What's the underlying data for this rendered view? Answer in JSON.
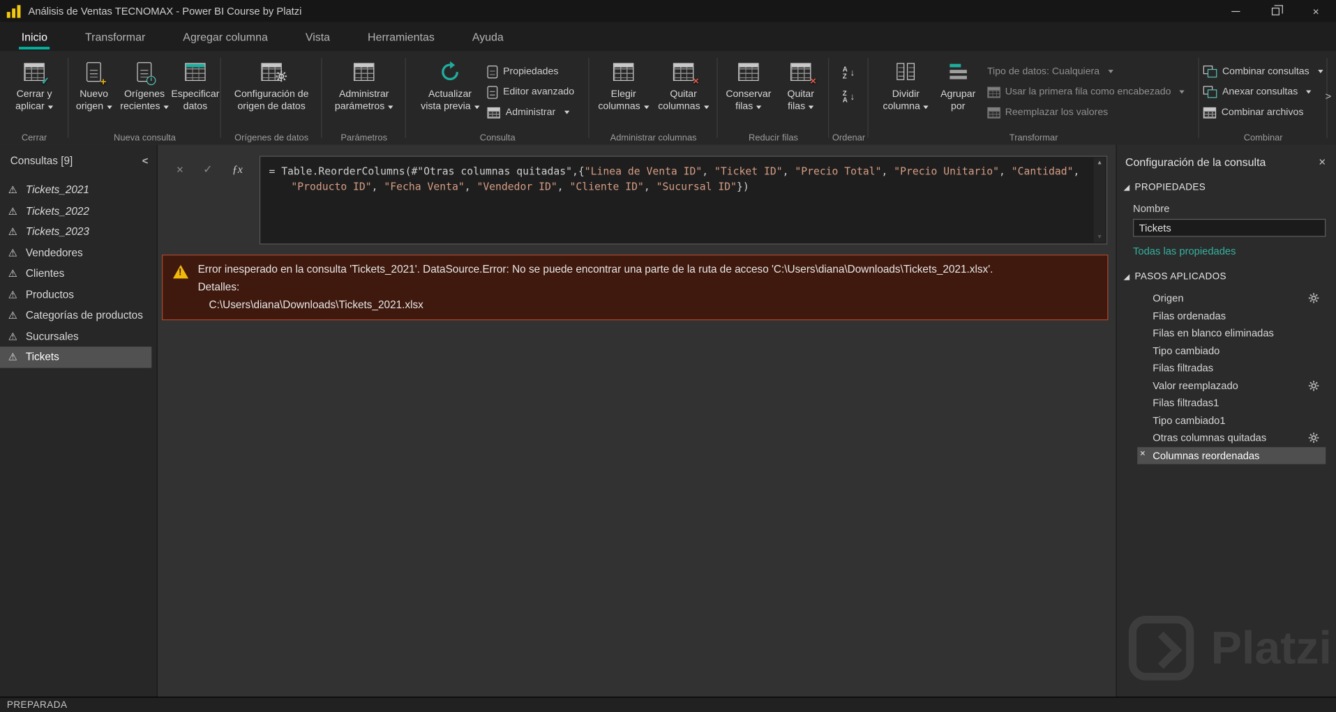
{
  "icons": {
    "close": "×",
    "check": "✓",
    "fx": "ƒx",
    "warning": "⚠",
    "scroll_up": "▲",
    "scroll_down": "▼",
    "collapse_left": "<",
    "overflow_right": ">",
    "plus": "+",
    "sort_a": "A",
    "sort_z": "Z",
    "arrow_down": "↓",
    "delete_x": "×"
  },
  "window": {
    "title": "Análisis de Ventas TECNOMAX - Power BI Course by Platzi"
  },
  "tabs": [
    "Inicio",
    "Transformar",
    "Agregar columna",
    "Vista",
    "Herramientas",
    "Ayuda"
  ],
  "ribbon": {
    "cerrar": {
      "label": "Cerrar",
      "close_apply": "Cerrar y aplicar"
    },
    "nueva": {
      "label": "Nueva consulta",
      "nuevo_origen": "Nuevo origen",
      "origenes_recientes": "Orígenes recientes",
      "especificar_datos": "Especificar datos"
    },
    "origenes": {
      "label": "Orígenes de datos",
      "configuracion": "Configuración de origen de datos"
    },
    "parametros": {
      "label": "Parámetros",
      "administrar": "Administrar parámetros"
    },
    "consulta": {
      "label": "Consulta",
      "actualizar": "Actualizar vista previa",
      "propiedades": "Propiedades",
      "editor_avanzado": "Editor avanzado",
      "administrar": "Administrar"
    },
    "columnas": {
      "label": "Administrar columnas",
      "elegir": "Elegir columnas",
      "quitar": "Quitar columnas"
    },
    "filas": {
      "label": "Reducir filas",
      "conservar": "Conservar filas",
      "quitar": "Quitar filas"
    },
    "ordenar": {
      "label": "Ordenar"
    },
    "transformar": {
      "label": "Transformar",
      "dividir": "Dividir columna",
      "agrupar": "Agrupar por",
      "tipo_datos": "Tipo de datos: Cualquiera",
      "primera_fila": "Usar la primera fila como encabezado",
      "reemplazar": "Reemplazar los valores"
    },
    "combinar": {
      "label": "Combinar",
      "combinar_consultas": "Combinar consultas",
      "anexar_consultas": "Anexar consultas",
      "combinar_archivos": "Combinar archivos"
    }
  },
  "sidebar": {
    "header": "Consultas [9]",
    "items": [
      "Tickets_2021",
      "Tickets_2022",
      "Tickets_2023",
      "Vendedores",
      "Clientes",
      "Productos",
      "Categorías de productos",
      "Sucursales",
      "Tickets"
    ]
  },
  "formula": {
    "p1": "= Table.ReorderColumns(",
    "identifier": "#\"Otras columnas quitadas\"",
    "p2": ",{",
    "sep": ", ",
    "trail": ",",
    "close": "})",
    "cols": [
      "\"Linea de Venta ID\"",
      "\"Ticket ID\"",
      "\"Precio Total\"",
      "\"Precio Unitario\"",
      "\"Cantidad\"",
      "\"Producto ID\"",
      "\"Fecha Venta\"",
      "\"Vendedor ID\"",
      "\"Cliente ID\"",
      "\"Sucursal ID\""
    ]
  },
  "error": {
    "message": "Error inesperado en la consulta 'Tickets_2021'. DataSource.Error: No se puede encontrar una parte de la ruta de acceso 'C:\\Users\\diana\\Downloads\\Tickets_2021.xlsx'.",
    "details_label": "Detalles:",
    "details_path": "C:\\Users\\diana\\Downloads\\Tickets_2021.xlsx"
  },
  "settings": {
    "title": "Configuración de la consulta",
    "properties_header": "PROPIEDADES",
    "name_label": "Nombre",
    "name_value": "Tickets",
    "all_properties": "Todas las propiedades",
    "steps_header": "PASOS APLICADOS",
    "steps": [
      "Origen",
      "Filas ordenadas",
      "Filas en blanco eliminadas",
      "Tipo cambiado",
      "Filas filtradas",
      "Valor reemplazado",
      "Filas filtradas1",
      "Tipo cambiado1",
      "Otras columnas quitadas",
      "Columnas reordenadas"
    ]
  },
  "status": {
    "text": "PREPARADA"
  },
  "watermark": {
    "text": "Platzi"
  },
  "colors": {
    "accent": "#00b7a3",
    "string_literal": "#d69d85",
    "error_bg": "#3f190e",
    "error_border": "#a9492f",
    "warning_yellow": "#f2c811",
    "selection_gray": "#515151"
  }
}
